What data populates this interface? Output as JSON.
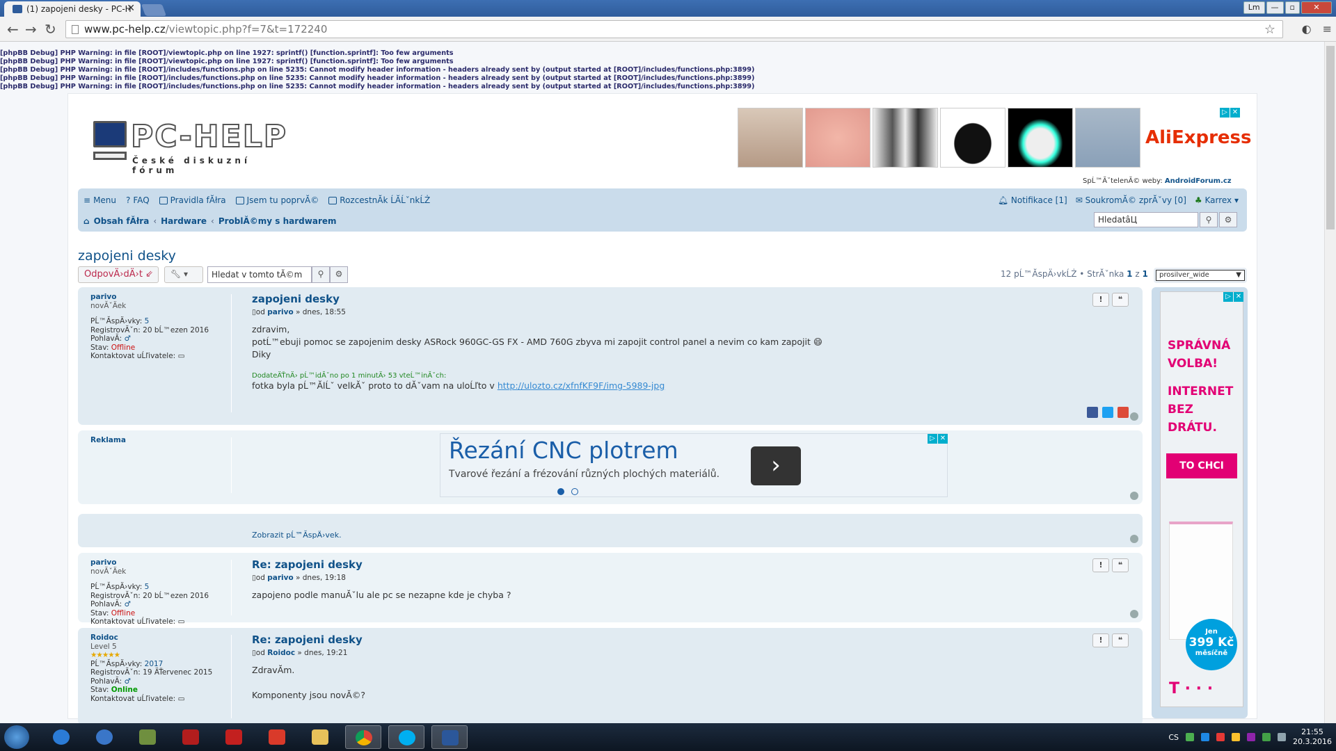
{
  "browser": {
    "tab_title": "(1) zapojeni desky - PC-H",
    "tab_close": "✕",
    "url_host": "www.pc-help.cz",
    "url_path": "/viewtopic.php?f=7&t=172240",
    "user_btn": "Lm",
    "win_min": "—",
    "win_max": "▫",
    "win_close": "✕"
  },
  "debug_lines": [
    "[phpBB Debug] PHP Warning: in file [ROOT]/viewtopic.php on line 1927: sprintf() [function.sprintf]: Too few arguments",
    "[phpBB Debug] PHP Warning: in file [ROOT]/viewtopic.php on line 1927: sprintf() [function.sprintf]: Too few arguments",
    "[phpBB Debug] PHP Warning: in file [ROOT]/includes/functions.php on line 5235: Cannot modify header information - headers already sent by (output started at [ROOT]/includes/functions.php:3899)",
    "[phpBB Debug] PHP Warning: in file [ROOT]/includes/functions.php on line 5235: Cannot modify header information - headers already sent by (output started at [ROOT]/includes/functions.php:3899)",
    "[phpBB Debug] PHP Warning: in file [ROOT]/includes/functions.php on line 5235: Cannot modify header information - headers already sent by (output started at [ROOT]/includes/functions.php:3899)"
  ],
  "logo": {
    "name": "PC-HELP",
    "tagline": "České diskuzní fórum"
  },
  "top_ad": {
    "brand": "AliExpress"
  },
  "partner": {
    "label": "SpĹ™Ă˘telenĂ© weby:",
    "site": "AndroidForum.cz"
  },
  "nav": {
    "menu": "Menu",
    "faq": "FAQ",
    "rules": "Pravidla fĂłra",
    "first": "Jsem tu poprvĂ©",
    "crossroads": "RozcestnĂ­k ĹĂ­ĹˇnkĹŻ",
    "notifications": "Notifikace [1]",
    "messages": "SoukromĂ© zprĂˇvy [0]",
    "user": "Karrex ▾",
    "crumb_home": "Obsah fĂłra",
    "crumb_hw": "Hardware",
    "crumb_problems": "ProblĂ©my s hardwarem",
    "search_value": "HledatâЦ"
  },
  "topic": {
    "title": "zapojeni desky",
    "reply_label": "OdpovÄ›dÄ›t ⇙",
    "topic_search": "Hledat v tomto tĂ©m",
    "pagination": "12 pĹ™ĂspÄ›vkĹŻ • StrĂˇnka",
    "page_current": "1",
    "page_sep": "z",
    "page_total": "1",
    "style": "prosilver_wide"
  },
  "posts": [
    {
      "author": "parivo",
      "rank": "novĂˇÄek",
      "posts_label": "PĹ™ĂspÄ›vky:",
      "posts_value": "5",
      "reg_label": "RegistrovĂˇn:",
      "reg_value": "20 bĹ™ezen 2016",
      "gender_label": "PohlavĂ:",
      "status_label": "Stav:",
      "status_value": "Offline",
      "contact_label": "Kontaktovat uĹľivatele:",
      "title": "zapojeni desky",
      "by": "od",
      "date": "» dnes, 18:55",
      "lines": [
        "zdravim,",
        "potĹ™ebuji pomoc se zapojenim desky ASRock 960GC-GS FX - AMD 760G zbyva mi zapojit control panel a nevim co kam zapojit 😄",
        "Diky"
      ],
      "edited": "DodateÄŤnÄ› pĹ™idĂˇno po 1 minutÄ› 53 vteĹ™inĂˇch:",
      "edited_text": "fotka byla pĹ™ĂlĹˇ velkĂˇ proto to dĂˇvam na uloĹľto v ",
      "link": "http://ulozto.cz/xfnfKF9F/img-5989-jpg"
    },
    {
      "label": "Reklama",
      "ad_title": "Řezání CNC plotrem",
      "ad_sub": "Tvarové řezání a frézování různých plochých materiálů.",
      "ad_arrow": "›"
    },
    {
      "show_post": "Zobrazit pĹ™ĂspÄ›vek."
    },
    {
      "author": "parivo",
      "rank": "novĂˇÄek",
      "posts_label": "PĹ™ĂspÄ›vky:",
      "posts_value": "5",
      "reg_label": "RegistrovĂˇn:",
      "reg_value": "20 bĹ™ezen 2016",
      "gender_label": "PohlavĂ:",
      "status_label": "Stav:",
      "status_value": "Offline",
      "contact_label": "Kontaktovat uĹľivatele:",
      "title": "Re: zapojeni desky",
      "by": "od",
      "date": "» dnes, 19:18",
      "text": "zapojeno podle manuĂˇlu ale pc se nezapne kde je chyba ?"
    },
    {
      "author": "Roidoc",
      "rank": "Level 5",
      "posts_label": "PĹ™ĂspÄ›vky:",
      "posts_value": "2017",
      "reg_label": "RegistrovĂˇn:",
      "reg_value": "19 ÄŤervenec 2015",
      "gender_label": "PohlavĂ:",
      "status_label": "Stav:",
      "status_value": "Online",
      "contact_label": "Kontaktovat uĹľivatele:",
      "title": "Re: zapojeni desky",
      "by": "od",
      "date": "» dnes, 19:21",
      "text": "ZdravĂ­m.",
      "text2": "Komponenty jsou novĂ©?"
    }
  ],
  "post_buttons": {
    "report": "!",
    "quote": "❝"
  },
  "side_ad": {
    "h1a": "SPRÁVNÁ",
    "h1b": "VOLBA!",
    "h2a": "INTERNET",
    "h2b": "BEZ DRÁTU.",
    "cta": "TO CHCI",
    "price_pre": "Jen",
    "price": "399 Kč",
    "price_post": "měsíčně",
    "logo": "T · · ·"
  },
  "taskbar": {
    "lang": "CS",
    "time": "21:55",
    "date": "20.3.2016"
  }
}
